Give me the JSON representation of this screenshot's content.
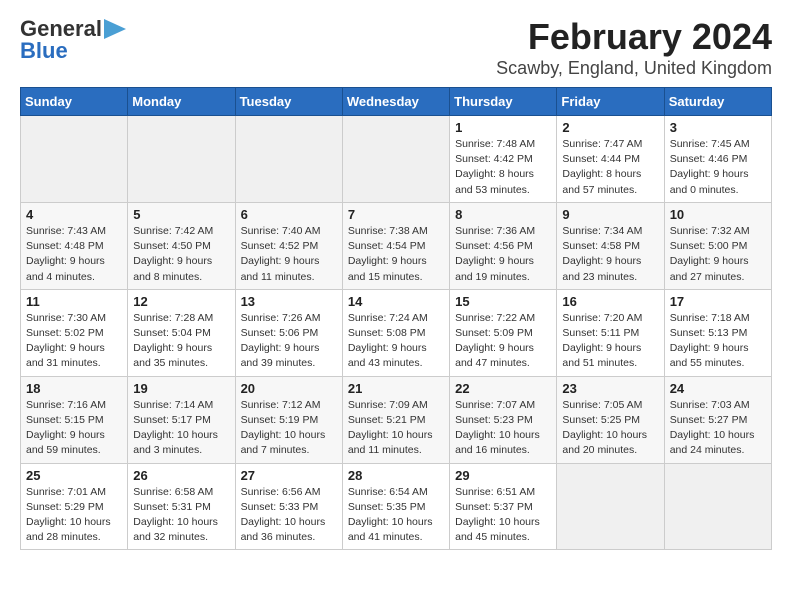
{
  "logo": {
    "line1": "General",
    "line2": "Blue"
  },
  "title": "February 2024",
  "subtitle": "Scawby, England, United Kingdom",
  "days_of_week": [
    "Sunday",
    "Monday",
    "Tuesday",
    "Wednesday",
    "Thursday",
    "Friday",
    "Saturday"
  ],
  "weeks": [
    [
      {
        "day": "",
        "info": ""
      },
      {
        "day": "",
        "info": ""
      },
      {
        "day": "",
        "info": ""
      },
      {
        "day": "",
        "info": ""
      },
      {
        "day": "1",
        "info": "Sunrise: 7:48 AM\nSunset: 4:42 PM\nDaylight: 8 hours\nand 53 minutes."
      },
      {
        "day": "2",
        "info": "Sunrise: 7:47 AM\nSunset: 4:44 PM\nDaylight: 8 hours\nand 57 minutes."
      },
      {
        "day": "3",
        "info": "Sunrise: 7:45 AM\nSunset: 4:46 PM\nDaylight: 9 hours\nand 0 minutes."
      }
    ],
    [
      {
        "day": "4",
        "info": "Sunrise: 7:43 AM\nSunset: 4:48 PM\nDaylight: 9 hours\nand 4 minutes."
      },
      {
        "day": "5",
        "info": "Sunrise: 7:42 AM\nSunset: 4:50 PM\nDaylight: 9 hours\nand 8 minutes."
      },
      {
        "day": "6",
        "info": "Sunrise: 7:40 AM\nSunset: 4:52 PM\nDaylight: 9 hours\nand 11 minutes."
      },
      {
        "day": "7",
        "info": "Sunrise: 7:38 AM\nSunset: 4:54 PM\nDaylight: 9 hours\nand 15 minutes."
      },
      {
        "day": "8",
        "info": "Sunrise: 7:36 AM\nSunset: 4:56 PM\nDaylight: 9 hours\nand 19 minutes."
      },
      {
        "day": "9",
        "info": "Sunrise: 7:34 AM\nSunset: 4:58 PM\nDaylight: 9 hours\nand 23 minutes."
      },
      {
        "day": "10",
        "info": "Sunrise: 7:32 AM\nSunset: 5:00 PM\nDaylight: 9 hours\nand 27 minutes."
      }
    ],
    [
      {
        "day": "11",
        "info": "Sunrise: 7:30 AM\nSunset: 5:02 PM\nDaylight: 9 hours\nand 31 minutes."
      },
      {
        "day": "12",
        "info": "Sunrise: 7:28 AM\nSunset: 5:04 PM\nDaylight: 9 hours\nand 35 minutes."
      },
      {
        "day": "13",
        "info": "Sunrise: 7:26 AM\nSunset: 5:06 PM\nDaylight: 9 hours\nand 39 minutes."
      },
      {
        "day": "14",
        "info": "Sunrise: 7:24 AM\nSunset: 5:08 PM\nDaylight: 9 hours\nand 43 minutes."
      },
      {
        "day": "15",
        "info": "Sunrise: 7:22 AM\nSunset: 5:09 PM\nDaylight: 9 hours\nand 47 minutes."
      },
      {
        "day": "16",
        "info": "Sunrise: 7:20 AM\nSunset: 5:11 PM\nDaylight: 9 hours\nand 51 minutes."
      },
      {
        "day": "17",
        "info": "Sunrise: 7:18 AM\nSunset: 5:13 PM\nDaylight: 9 hours\nand 55 minutes."
      }
    ],
    [
      {
        "day": "18",
        "info": "Sunrise: 7:16 AM\nSunset: 5:15 PM\nDaylight: 9 hours\nand 59 minutes."
      },
      {
        "day": "19",
        "info": "Sunrise: 7:14 AM\nSunset: 5:17 PM\nDaylight: 10 hours\nand 3 minutes."
      },
      {
        "day": "20",
        "info": "Sunrise: 7:12 AM\nSunset: 5:19 PM\nDaylight: 10 hours\nand 7 minutes."
      },
      {
        "day": "21",
        "info": "Sunrise: 7:09 AM\nSunset: 5:21 PM\nDaylight: 10 hours\nand 11 minutes."
      },
      {
        "day": "22",
        "info": "Sunrise: 7:07 AM\nSunset: 5:23 PM\nDaylight: 10 hours\nand 16 minutes."
      },
      {
        "day": "23",
        "info": "Sunrise: 7:05 AM\nSunset: 5:25 PM\nDaylight: 10 hours\nand 20 minutes."
      },
      {
        "day": "24",
        "info": "Sunrise: 7:03 AM\nSunset: 5:27 PM\nDaylight: 10 hours\nand 24 minutes."
      }
    ],
    [
      {
        "day": "25",
        "info": "Sunrise: 7:01 AM\nSunset: 5:29 PM\nDaylight: 10 hours\nand 28 minutes."
      },
      {
        "day": "26",
        "info": "Sunrise: 6:58 AM\nSunset: 5:31 PM\nDaylight: 10 hours\nand 32 minutes."
      },
      {
        "day": "27",
        "info": "Sunrise: 6:56 AM\nSunset: 5:33 PM\nDaylight: 10 hours\nand 36 minutes."
      },
      {
        "day": "28",
        "info": "Sunrise: 6:54 AM\nSunset: 5:35 PM\nDaylight: 10 hours\nand 41 minutes."
      },
      {
        "day": "29",
        "info": "Sunrise: 6:51 AM\nSunset: 5:37 PM\nDaylight: 10 hours\nand 45 minutes."
      },
      {
        "day": "",
        "info": ""
      },
      {
        "day": "",
        "info": ""
      }
    ]
  ]
}
